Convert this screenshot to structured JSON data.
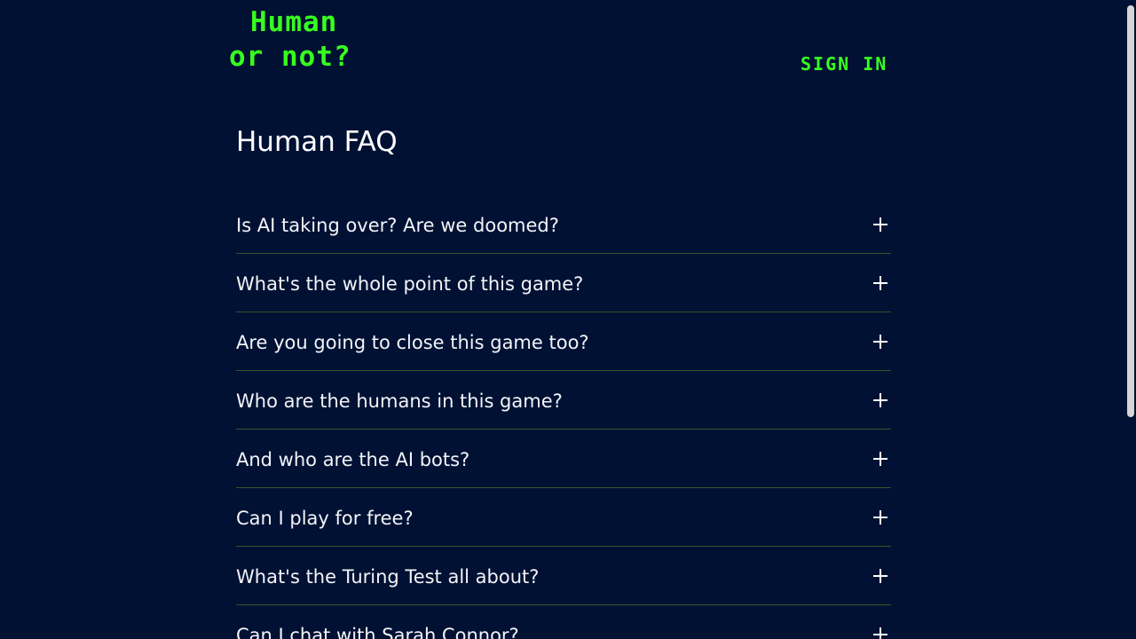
{
  "header": {
    "logo_line1": "Human",
    "logo_line2": "or not?",
    "signin_label": "SIGN IN"
  },
  "main": {
    "title": "Human FAQ",
    "faq": [
      {
        "question": "Is AI taking over? Are we doomed?"
      },
      {
        "question": "What's the whole point of this game?"
      },
      {
        "question": "Are you going to close this game too?"
      },
      {
        "question": "Who are the humans in this game?"
      },
      {
        "question": "And who are the AI bots?"
      },
      {
        "question": "Can I play for free?"
      },
      {
        "question": "What's the Turing Test all about?"
      },
      {
        "question": "Can I chat with Sarah Connor?"
      }
    ],
    "expand_icon": "plus-icon"
  },
  "colors": {
    "background": "#001133",
    "accent": "#37ff1f",
    "divider": "#2f5a2a",
    "text": "#ffffff"
  }
}
